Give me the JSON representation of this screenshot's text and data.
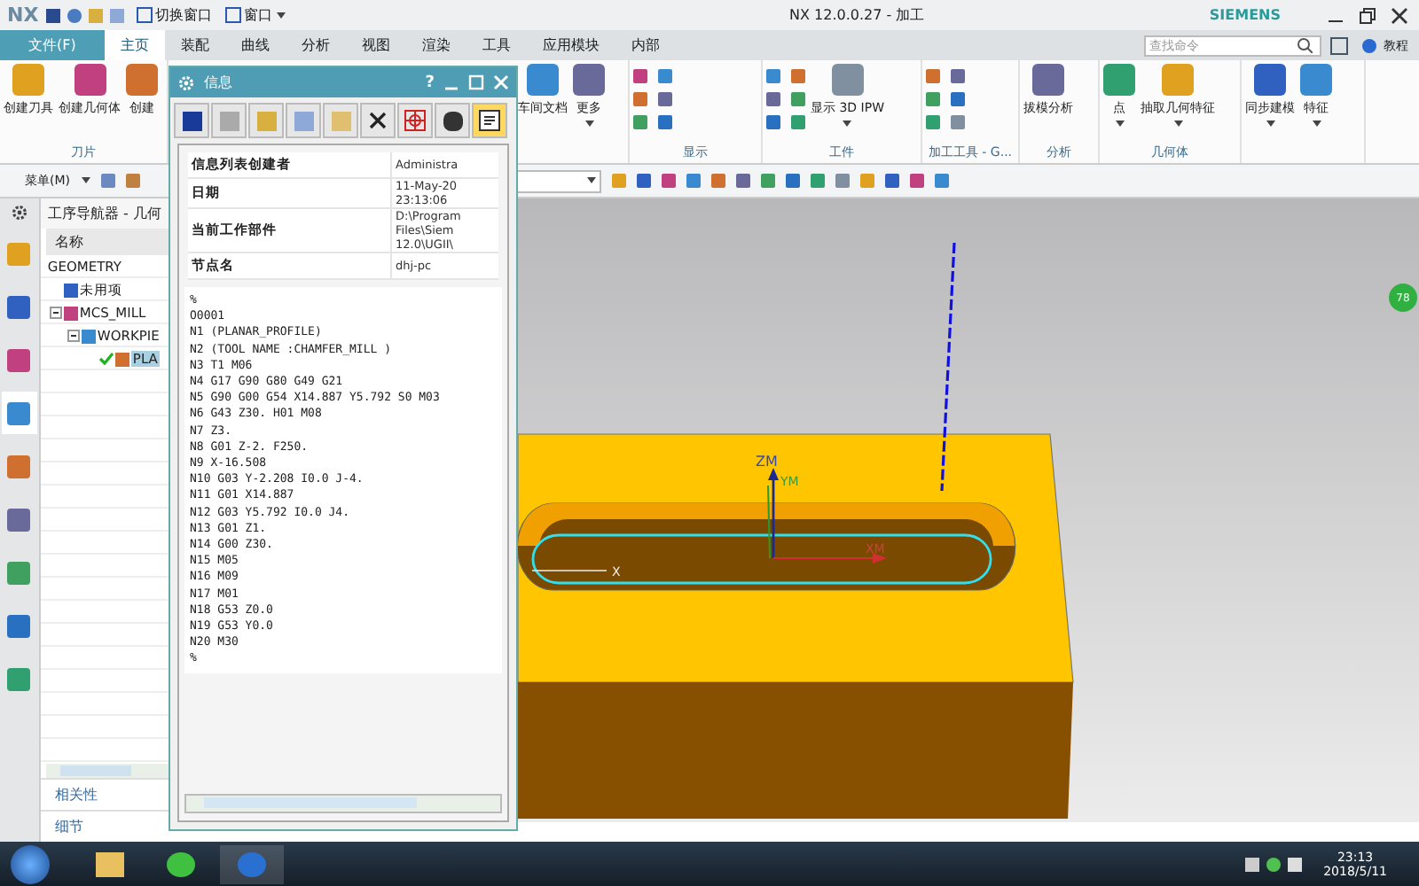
{
  "title_bar": {
    "logo": "NX",
    "quick_actions": [
      {
        "label": "切换窗口",
        "dropdown": false
      },
      {
        "label": "窗口",
        "dropdown": true
      }
    ],
    "title": "NX 12.0.0.27 - 加工",
    "brand": "SIEMENS"
  },
  "ribbon_tabs": [
    {
      "label": "文件(F)",
      "kind": "file",
      "selected": false
    },
    {
      "label": "主页",
      "kind": "tab",
      "selected": true
    },
    {
      "label": "装配",
      "kind": "tab",
      "selected": false
    },
    {
      "label": "曲线",
      "kind": "tab",
      "selected": false
    },
    {
      "label": "分析",
      "kind": "tab",
      "selected": false
    },
    {
      "label": "视图",
      "kind": "tab",
      "selected": false
    },
    {
      "label": "渲染",
      "kind": "tab",
      "selected": false
    },
    {
      "label": "工具",
      "kind": "tab",
      "selected": false
    },
    {
      "label": "应用模块",
      "kind": "tab",
      "selected": false
    },
    {
      "label": "内部",
      "kind": "tab",
      "selected": false
    }
  ],
  "search": {
    "placeholder": "查找命令"
  },
  "help_link": "教程",
  "ribbon_groups": [
    {
      "label": "刀片",
      "kind": "large",
      "commands": [
        {
          "label": "创建刀具",
          "dropdown": false
        },
        {
          "label": "创建几何体",
          "dropdown": false
        },
        {
          "label": "创建",
          "dropdown": false
        }
      ]
    },
    {
      "kind": "large",
      "commands": [
        {
          "label": "车间文档",
          "dropdown": false
        },
        {
          "label": "更多",
          "dropdown": true
        }
      ]
    },
    {
      "label": "显示",
      "kind": "small"
    },
    {
      "label": "工件",
      "kind": "mixed",
      "commands": [
        {
          "label": "显示 3D IPW",
          "dropdown": true
        }
      ]
    },
    {
      "label": "加工工具 - G...",
      "kind": "small"
    },
    {
      "label": "分析",
      "kind": "large",
      "commands": [
        {
          "label": "拔模分析",
          "dropdown": false
        }
      ]
    },
    {
      "label": "几何体",
      "kind": "large",
      "commands": [
        {
          "label": "点",
          "dropdown": true
        },
        {
          "label": "抽取几何特征",
          "dropdown": true
        }
      ]
    },
    {
      "kind": "large",
      "commands": [
        {
          "label": "同步建模",
          "dropdown": true
        },
        {
          "label": "特征",
          "dropdown": true
        }
      ]
    }
  ],
  "toolbar": {
    "menu_label": "菜单(M)"
  },
  "navigator": {
    "title": "工序导航器 - 几何",
    "column": "名称",
    "tree": [
      {
        "label": "GEOMETRY",
        "selected": false,
        "done": false,
        "children": [
          {
            "label": "未用项",
            "selected": false,
            "done": false
          },
          {
            "label": "MCS_MILL",
            "selected": false,
            "done": false,
            "expanded": true,
            "children": [
              {
                "label": "WORKPIE",
                "selected": false,
                "done": false,
                "expanded": true,
                "children": [
                  {
                    "label": "PLA",
                    "selected": true,
                    "done": true
                  }
                ]
              }
            ]
          }
        ]
      }
    ],
    "panels": [
      "相关性",
      "细节"
    ]
  },
  "info_dialog": {
    "title": "信息",
    "help": "?",
    "fields": [
      {
        "label": "信息列表创建者",
        "value_lines": [
          "Administra"
        ]
      },
      {
        "label": "日期",
        "value_lines": [
          "11-May-20",
          "23:13:06"
        ]
      },
      {
        "label": "当前工作部件",
        "value_lines": [
          "D:\\Program",
          "Files\\Siem",
          "12.0\\UGII\\"
        ]
      },
      {
        "label": "节点名",
        "value_lines": [
          "dhj-pc"
        ]
      }
    ],
    "listing": [
      "%",
      "O0001",
      "N1 (PLANAR_PROFILE)",
      "N2 (TOOL NAME :CHAMFER_MILL )",
      "N3 T1 M06",
      "N4 G17 G90 G80 G49 G21",
      "N5 G90 G00 G54 X14.887 Y5.792 S0 M03",
      "N6 G43 Z30. H01 M08",
      "N7 Z3.",
      "N8 G01 Z-2. F250.",
      "N9 X-16.508",
      "N10 G03 Y-2.208 I0.0 J-4.",
      "N11 G01 X14.887",
      "N12 G03 Y5.792 I0.0 J4.",
      "N13 G01 Z1.",
      "N14 G00 Z30.",
      "N15 M05",
      "N16 M09",
      "N17 M01",
      "N18 G53 Z0.0",
      "N19 G53 Y0.0",
      "N20 M30",
      "%"
    ]
  },
  "viewport": {
    "badge": "78",
    "axis_labels": [
      "ZM",
      "YM",
      "XM",
      "X"
    ]
  },
  "taskbar": {
    "time": "23:13",
    "date": "2018/5/11"
  }
}
